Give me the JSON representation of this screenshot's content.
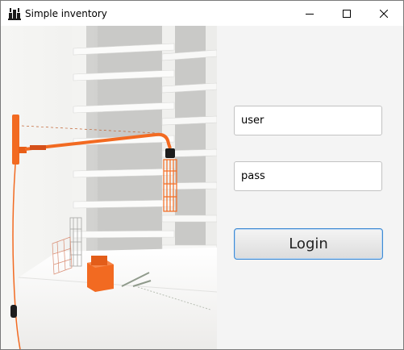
{
  "window": {
    "title": "Simple inventory"
  },
  "title_bar": {
    "icons": {
      "app": "inventory-app-icon",
      "minimize": "minimize-icon",
      "maximize": "maximize-icon",
      "close": "close-icon"
    }
  },
  "login": {
    "username_value": "user",
    "password_value": "pass",
    "button_label": "Login"
  },
  "colors": {
    "accent": "#3f8ad3",
    "lamp_orange": "#f26a21"
  }
}
